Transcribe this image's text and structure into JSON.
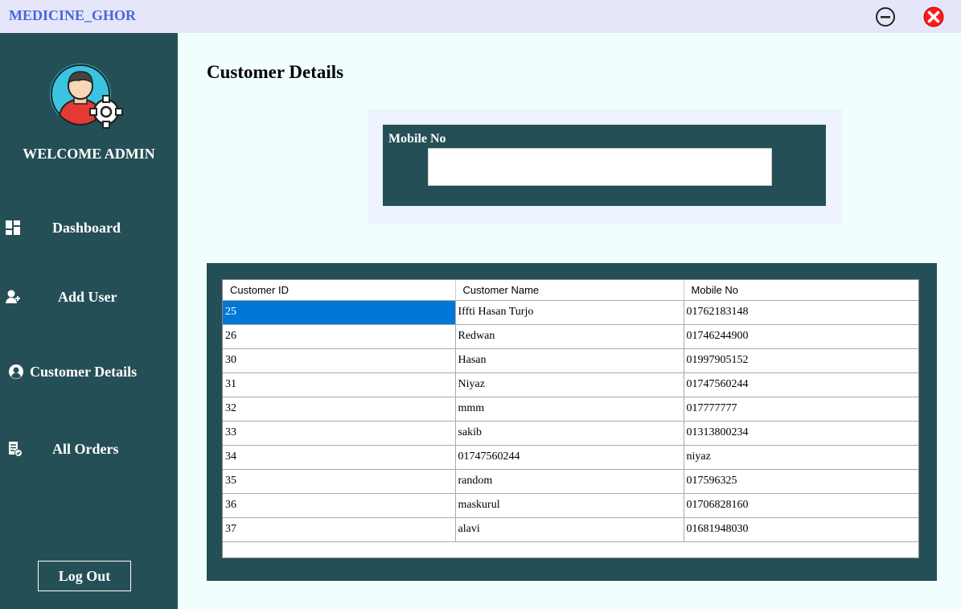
{
  "app": {
    "title": "MEDICINE_GHOR"
  },
  "window_controls": {
    "minimize_icon": "minus-circle-icon",
    "close_icon": "x-circle-icon",
    "close_color": "#ff0000"
  },
  "sidebar": {
    "welcome": "WELCOME ADMIN",
    "avatar_icon": "admin-gear-avatar",
    "items": [
      {
        "label": "Dashboard",
        "icon": "dashboard-grid-icon"
      },
      {
        "label": "Add User",
        "icon": "add-user-icon"
      },
      {
        "label": "Customer Details",
        "icon": "user-circle-icon"
      },
      {
        "label": "All Orders",
        "icon": "orders-document-icon"
      }
    ],
    "logout_label": "Log Out"
  },
  "main": {
    "title": "Customer Details",
    "search": {
      "label": "Mobile No",
      "value": ""
    },
    "table": {
      "columns": [
        "Customer ID",
        "Customer Name",
        "Mobile No"
      ],
      "rows": [
        [
          "25",
          "Iffti Hasan Turjo",
          "01762183148"
        ],
        [
          "26",
          "Redwan",
          "01746244900"
        ],
        [
          "30",
          "Hasan",
          "01997905152"
        ],
        [
          "31",
          "Niyaz",
          "01747560244"
        ],
        [
          "32",
          "mmm",
          "017777777"
        ],
        [
          "33",
          "sakib",
          "01313800234"
        ],
        [
          "34",
          "01747560244",
          "niyaz"
        ],
        [
          "35",
          "random",
          "017596325"
        ],
        [
          "36",
          "maskurul",
          "01706828160"
        ],
        [
          "37",
          "alavi",
          "01681948030"
        ]
      ],
      "selected_cell": "25"
    }
  },
  "colors": {
    "sidebar": "#254f56",
    "accent": "#4a66d8",
    "selection": "#0078d7"
  }
}
